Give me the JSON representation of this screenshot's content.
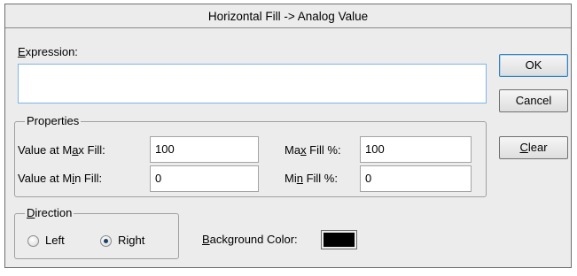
{
  "window": {
    "title": "Horizontal Fill -> Analog Value"
  },
  "expression": {
    "label_underlined": "E",
    "label_rest": "xpression:",
    "value": ""
  },
  "buttons": {
    "ok": "OK",
    "cancel": "Cancel",
    "clear_underlined": "C",
    "clear_rest": "lear"
  },
  "properties": {
    "group_label": "Properties",
    "value_at_max_fill": {
      "label_pre": "Value at M",
      "label_underlined": "a",
      "label_post": "x Fill:",
      "value": "100"
    },
    "value_at_min_fill": {
      "label_pre": "Value at M",
      "label_underlined": "i",
      "label_post": "n Fill:",
      "value": "0"
    },
    "max_fill_pct": {
      "label_pre": "Ma",
      "label_underlined": "x",
      "label_post": " Fill %:",
      "value": "100"
    },
    "min_fill_pct": {
      "label_pre": "Mi",
      "label_underlined": "n",
      "label_post": " Fill %:",
      "value": "0"
    }
  },
  "direction": {
    "group_label_underlined": "D",
    "group_label_rest": "irection",
    "options": [
      {
        "label": "Left",
        "selected": false
      },
      {
        "label": "Right",
        "selected": true
      }
    ]
  },
  "background_color": {
    "label_underlined": "B",
    "label_rest": "ackground Color:",
    "color": "#000000"
  }
}
